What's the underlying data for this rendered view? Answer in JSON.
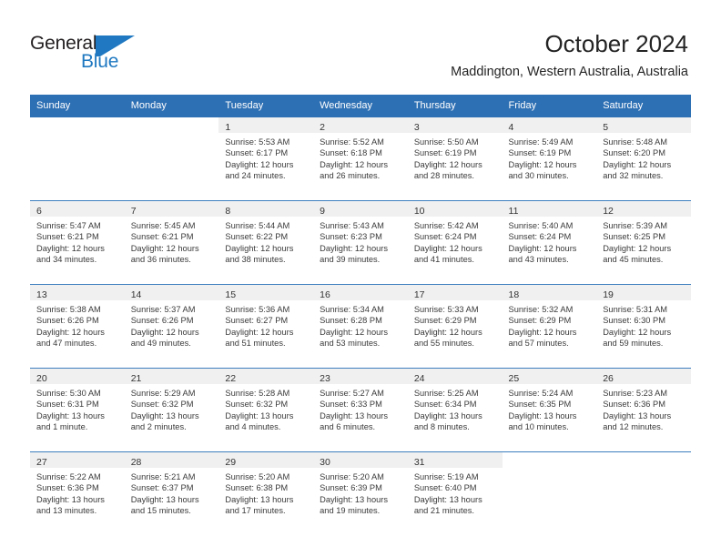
{
  "brand": {
    "name_part1": "General",
    "name_part2": "Blue",
    "logo_icon": "flag-triangle-icon",
    "accent_color": "#1f78c1"
  },
  "header": {
    "title": "October 2024",
    "subtitle": "Maddington, Western Australia, Australia"
  },
  "theme": {
    "header_blue": "#2e70b4",
    "daynum_band_gray": "#f0f0f0",
    "row_divider": "#3f7fbf",
    "text": "#3a3a3a"
  },
  "weekday_headers": [
    "Sunday",
    "Monday",
    "Tuesday",
    "Wednesday",
    "Thursday",
    "Friday",
    "Saturday"
  ],
  "weeks": [
    [
      {
        "day": "",
        "sunrise": "",
        "sunset": "",
        "daylight_line1": "",
        "daylight_line2": ""
      },
      {
        "day": "",
        "sunrise": "",
        "sunset": "",
        "daylight_line1": "",
        "daylight_line2": ""
      },
      {
        "day": "1",
        "sunrise": "Sunrise: 5:53 AM",
        "sunset": "Sunset: 6:17 PM",
        "daylight_line1": "Daylight: 12 hours",
        "daylight_line2": "and 24 minutes."
      },
      {
        "day": "2",
        "sunrise": "Sunrise: 5:52 AM",
        "sunset": "Sunset: 6:18 PM",
        "daylight_line1": "Daylight: 12 hours",
        "daylight_line2": "and 26 minutes."
      },
      {
        "day": "3",
        "sunrise": "Sunrise: 5:50 AM",
        "sunset": "Sunset: 6:19 PM",
        "daylight_line1": "Daylight: 12 hours",
        "daylight_line2": "and 28 minutes."
      },
      {
        "day": "4",
        "sunrise": "Sunrise: 5:49 AM",
        "sunset": "Sunset: 6:19 PM",
        "daylight_line1": "Daylight: 12 hours",
        "daylight_line2": "and 30 minutes."
      },
      {
        "day": "5",
        "sunrise": "Sunrise: 5:48 AM",
        "sunset": "Sunset: 6:20 PM",
        "daylight_line1": "Daylight: 12 hours",
        "daylight_line2": "and 32 minutes."
      }
    ],
    [
      {
        "day": "6",
        "sunrise": "Sunrise: 5:47 AM",
        "sunset": "Sunset: 6:21 PM",
        "daylight_line1": "Daylight: 12 hours",
        "daylight_line2": "and 34 minutes."
      },
      {
        "day": "7",
        "sunrise": "Sunrise: 5:45 AM",
        "sunset": "Sunset: 6:21 PM",
        "daylight_line1": "Daylight: 12 hours",
        "daylight_line2": "and 36 minutes."
      },
      {
        "day": "8",
        "sunrise": "Sunrise: 5:44 AM",
        "sunset": "Sunset: 6:22 PM",
        "daylight_line1": "Daylight: 12 hours",
        "daylight_line2": "and 38 minutes."
      },
      {
        "day": "9",
        "sunrise": "Sunrise: 5:43 AM",
        "sunset": "Sunset: 6:23 PM",
        "daylight_line1": "Daylight: 12 hours",
        "daylight_line2": "and 39 minutes."
      },
      {
        "day": "10",
        "sunrise": "Sunrise: 5:42 AM",
        "sunset": "Sunset: 6:24 PM",
        "daylight_line1": "Daylight: 12 hours",
        "daylight_line2": "and 41 minutes."
      },
      {
        "day": "11",
        "sunrise": "Sunrise: 5:40 AM",
        "sunset": "Sunset: 6:24 PM",
        "daylight_line1": "Daylight: 12 hours",
        "daylight_line2": "and 43 minutes."
      },
      {
        "day": "12",
        "sunrise": "Sunrise: 5:39 AM",
        "sunset": "Sunset: 6:25 PM",
        "daylight_line1": "Daylight: 12 hours",
        "daylight_line2": "and 45 minutes."
      }
    ],
    [
      {
        "day": "13",
        "sunrise": "Sunrise: 5:38 AM",
        "sunset": "Sunset: 6:26 PM",
        "daylight_line1": "Daylight: 12 hours",
        "daylight_line2": "and 47 minutes."
      },
      {
        "day": "14",
        "sunrise": "Sunrise: 5:37 AM",
        "sunset": "Sunset: 6:26 PM",
        "daylight_line1": "Daylight: 12 hours",
        "daylight_line2": "and 49 minutes."
      },
      {
        "day": "15",
        "sunrise": "Sunrise: 5:36 AM",
        "sunset": "Sunset: 6:27 PM",
        "daylight_line1": "Daylight: 12 hours",
        "daylight_line2": "and 51 minutes."
      },
      {
        "day": "16",
        "sunrise": "Sunrise: 5:34 AM",
        "sunset": "Sunset: 6:28 PM",
        "daylight_line1": "Daylight: 12 hours",
        "daylight_line2": "and 53 minutes."
      },
      {
        "day": "17",
        "sunrise": "Sunrise: 5:33 AM",
        "sunset": "Sunset: 6:29 PM",
        "daylight_line1": "Daylight: 12 hours",
        "daylight_line2": "and 55 minutes."
      },
      {
        "day": "18",
        "sunrise": "Sunrise: 5:32 AM",
        "sunset": "Sunset: 6:29 PM",
        "daylight_line1": "Daylight: 12 hours",
        "daylight_line2": "and 57 minutes."
      },
      {
        "day": "19",
        "sunrise": "Sunrise: 5:31 AM",
        "sunset": "Sunset: 6:30 PM",
        "daylight_line1": "Daylight: 12 hours",
        "daylight_line2": "and 59 minutes."
      }
    ],
    [
      {
        "day": "20",
        "sunrise": "Sunrise: 5:30 AM",
        "sunset": "Sunset: 6:31 PM",
        "daylight_line1": "Daylight: 13 hours",
        "daylight_line2": "and 1 minute."
      },
      {
        "day": "21",
        "sunrise": "Sunrise: 5:29 AM",
        "sunset": "Sunset: 6:32 PM",
        "daylight_line1": "Daylight: 13 hours",
        "daylight_line2": "and 2 minutes."
      },
      {
        "day": "22",
        "sunrise": "Sunrise: 5:28 AM",
        "sunset": "Sunset: 6:32 PM",
        "daylight_line1": "Daylight: 13 hours",
        "daylight_line2": "and 4 minutes."
      },
      {
        "day": "23",
        "sunrise": "Sunrise: 5:27 AM",
        "sunset": "Sunset: 6:33 PM",
        "daylight_line1": "Daylight: 13 hours",
        "daylight_line2": "and 6 minutes."
      },
      {
        "day": "24",
        "sunrise": "Sunrise: 5:25 AM",
        "sunset": "Sunset: 6:34 PM",
        "daylight_line1": "Daylight: 13 hours",
        "daylight_line2": "and 8 minutes."
      },
      {
        "day": "25",
        "sunrise": "Sunrise: 5:24 AM",
        "sunset": "Sunset: 6:35 PM",
        "daylight_line1": "Daylight: 13 hours",
        "daylight_line2": "and 10 minutes."
      },
      {
        "day": "26",
        "sunrise": "Sunrise: 5:23 AM",
        "sunset": "Sunset: 6:36 PM",
        "daylight_line1": "Daylight: 13 hours",
        "daylight_line2": "and 12 minutes."
      }
    ],
    [
      {
        "day": "27",
        "sunrise": "Sunrise: 5:22 AM",
        "sunset": "Sunset: 6:36 PM",
        "daylight_line1": "Daylight: 13 hours",
        "daylight_line2": "and 13 minutes."
      },
      {
        "day": "28",
        "sunrise": "Sunrise: 5:21 AM",
        "sunset": "Sunset: 6:37 PM",
        "daylight_line1": "Daylight: 13 hours",
        "daylight_line2": "and 15 minutes."
      },
      {
        "day": "29",
        "sunrise": "Sunrise: 5:20 AM",
        "sunset": "Sunset: 6:38 PM",
        "daylight_line1": "Daylight: 13 hours",
        "daylight_line2": "and 17 minutes."
      },
      {
        "day": "30",
        "sunrise": "Sunrise: 5:20 AM",
        "sunset": "Sunset: 6:39 PM",
        "daylight_line1": "Daylight: 13 hours",
        "daylight_line2": "and 19 minutes."
      },
      {
        "day": "31",
        "sunrise": "Sunrise: 5:19 AM",
        "sunset": "Sunset: 6:40 PM",
        "daylight_line1": "Daylight: 13 hours",
        "daylight_line2": "and 21 minutes."
      },
      {
        "day": "",
        "sunrise": "",
        "sunset": "",
        "daylight_line1": "",
        "daylight_line2": ""
      },
      {
        "day": "",
        "sunrise": "",
        "sunset": "",
        "daylight_line1": "",
        "daylight_line2": ""
      }
    ]
  ]
}
